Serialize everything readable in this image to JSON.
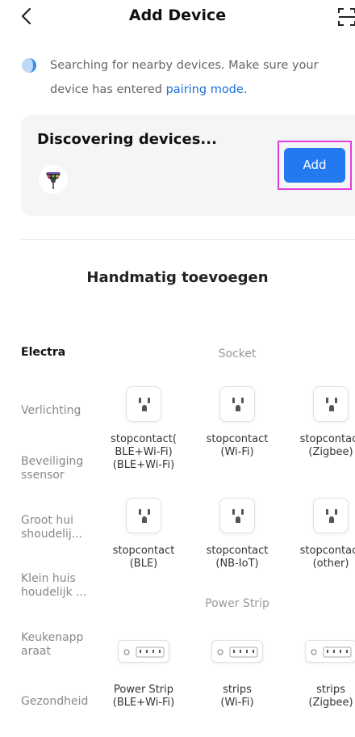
{
  "header": {
    "title": "Add Device",
    "back_icon": "chevron-left-icon",
    "scan_icon": "scan-icon"
  },
  "info": {
    "text": "Searching for nearby devices. Make sure your device has entered ",
    "link": "pairing mode",
    "suffix": "."
  },
  "discover": {
    "title": "Discovering devices...",
    "add_label": "Add"
  },
  "manual": {
    "title": "Handmatig toevoegen"
  },
  "categories": [
    {
      "label": "Electra",
      "active": true
    },
    {
      "label": "Verlichting"
    },
    {
      "label": "Beveiliging ssensor"
    },
    {
      "label": "Groot hui shoudelij..."
    },
    {
      "label": "Klein huis houdelijk ..."
    },
    {
      "label": "Keukenapp araat"
    },
    {
      "label": "Gezondheid"
    }
  ],
  "sections": [
    {
      "label": "Socket",
      "items": [
        {
          "label": "stopcontact( BLE+Wi-Fi) (BLE+Wi-Fi)",
          "lines": [
            "stopcontact(",
            "BLE+Wi-Fi)",
            "(BLE+Wi-Fi)"
          ]
        },
        {
          "label": "stopcontact (Wi-Fi)",
          "lines": [
            "stopcontact",
            "(Wi-Fi)"
          ]
        },
        {
          "label": "stopcontact (Zigbee)",
          "lines": [
            "stopcontact",
            "(Zigbee)"
          ]
        },
        {
          "label": "stopcontact (BLE)",
          "lines": [
            "stopcontact",
            "(BLE)"
          ]
        },
        {
          "label": "stopcontact (NB-IoT)",
          "lines": [
            "stopcontact",
            "(NB-IoT)"
          ]
        },
        {
          "label": "stopcontact (other)",
          "lines": [
            "stopcontact",
            "(other)"
          ]
        }
      ]
    },
    {
      "label": "Power Strip",
      "items": [
        {
          "label": "Power Strip (BLE+Wi-Fi)",
          "lines": [
            "Power Strip",
            "(BLE+Wi-Fi)"
          ]
        },
        {
          "label": "strips (Wi-Fi)",
          "lines": [
            "strips",
            "(Wi-Fi)"
          ]
        },
        {
          "label": "strips (Zigbee)",
          "lines": [
            "strips",
            "(Zigbee)"
          ]
        }
      ]
    }
  ],
  "colors": {
    "accent": "#2379f0",
    "link": "#1c6fdc",
    "highlight": "#e23fd6",
    "card": "#f4f5f7"
  }
}
